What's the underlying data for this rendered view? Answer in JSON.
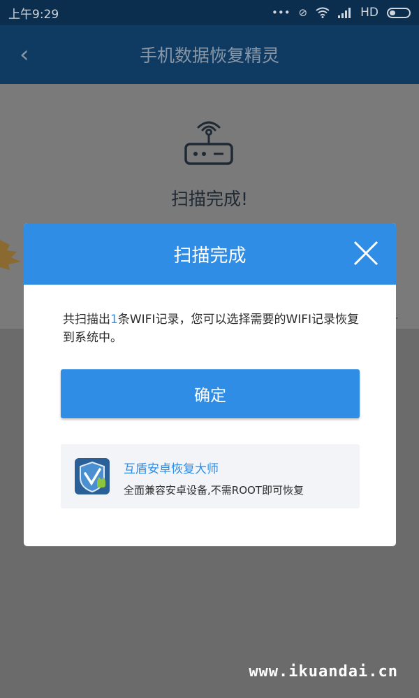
{
  "status_bar": {
    "time": "上午9:29",
    "network_label": "HD"
  },
  "header": {
    "title": "手机数据恢复精灵",
    "back_icon": "chevron-left-icon"
  },
  "background_page": {
    "status_text": "扫描完成!"
  },
  "dialog": {
    "title": "扫描完成",
    "message_before": "共扫描出",
    "message_count": "1",
    "message_after": "条WIFI记录，您可以选择需要的WIFI记录恢复到系统中。",
    "ok_label": "确定",
    "promo": {
      "title": "互盾安卓恢复大师",
      "description": "全面兼容安卓设备,不需ROOT即可恢复"
    }
  },
  "watermark": "www.ikuandai.cn",
  "colors": {
    "accent": "#2f8de6",
    "header_bg": "#0f3b63",
    "overlay": "#6b6b6b"
  }
}
